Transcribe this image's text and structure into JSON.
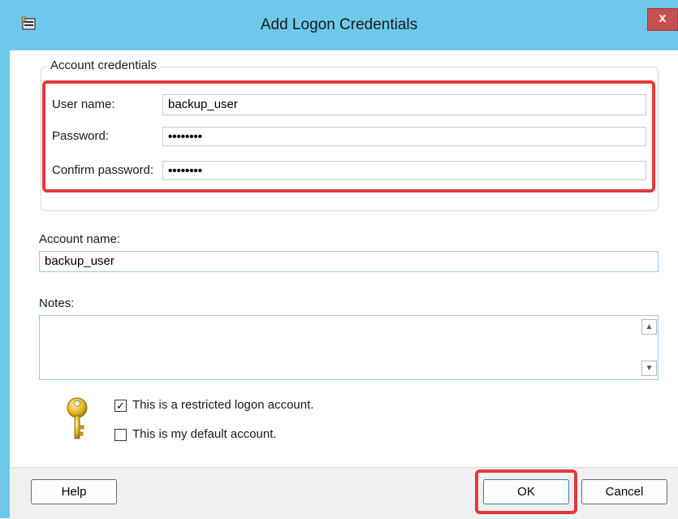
{
  "window": {
    "title": "Add Logon Credentials",
    "close_glyph": "x",
    "accent_color": "#6ec8ea",
    "highlight_color": "#e23a3a"
  },
  "account_credentials": {
    "legend": "Account credentials",
    "user_name_label": "User name:",
    "user_name_value": "backup_user",
    "password_label": "Password:",
    "password_value": "••••••••",
    "confirm_password_label": "Confirm password:",
    "confirm_password_value": "••••••••"
  },
  "account_name": {
    "label": "Account name:",
    "value": "backup_user"
  },
  "notes": {
    "label": "Notes:",
    "value": ""
  },
  "options": {
    "restricted_label": "This is a restricted logon account.",
    "restricted_checked": true,
    "default_label": "This is my default account.",
    "default_checked": false,
    "icon": "key-icon"
  },
  "buttons": {
    "help": "Help",
    "ok": "OK",
    "cancel": "Cancel"
  }
}
